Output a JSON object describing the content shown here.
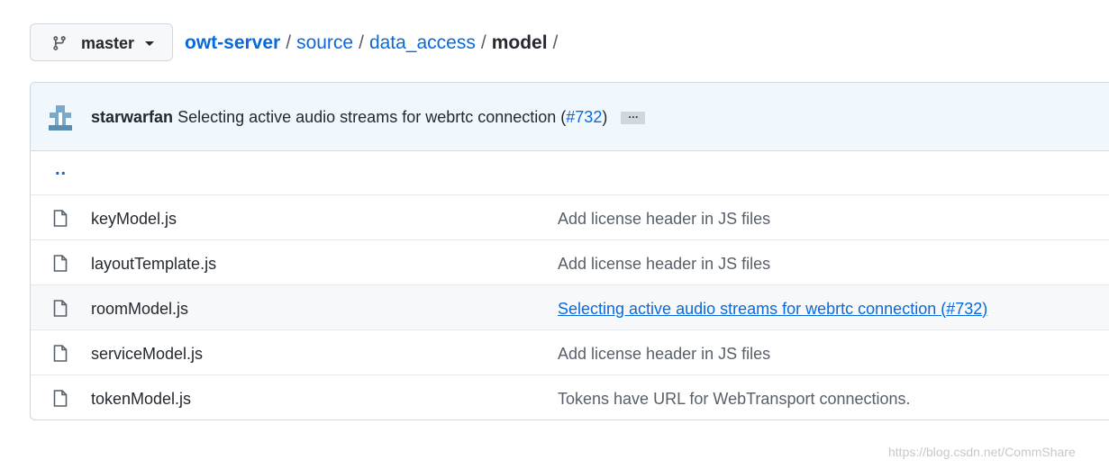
{
  "branch": {
    "label": "master",
    "icon": "git-branch-icon"
  },
  "breadcrumb": {
    "root": "owt-server",
    "sep": "/",
    "parts": [
      "source",
      "data_access"
    ],
    "current": "model"
  },
  "commit": {
    "author": "starwarfan",
    "message": "Selecting active audio streams for webrtc connection (",
    "pr": "#732",
    "close": ")",
    "ellipsis": "…"
  },
  "parent_link": "..",
  "files": [
    {
      "name": "keyModel.js",
      "message": "Add license header in JS files"
    },
    {
      "name": "layoutTemplate.js",
      "message": "Add license header in JS files"
    },
    {
      "name": "roomModel.js",
      "message": "Selecting active audio streams for webrtc connection (",
      "pr": "#732",
      "close": ")"
    },
    {
      "name": "serviceModel.js",
      "message": "Add license header in JS files"
    },
    {
      "name": "tokenModel.js",
      "message": "Tokens have URL for WebTransport connections."
    }
  ],
  "watermark": "https://blog.csdn.net/CommShare",
  "colors": {
    "link": "#0969da",
    "commit_bar": "#f0f7fd",
    "border": "#d0d7de"
  }
}
